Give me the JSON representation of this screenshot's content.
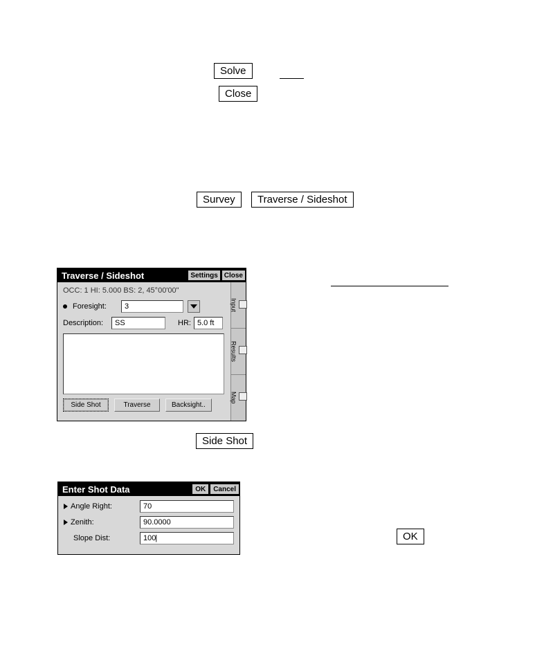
{
  "top_labels": {
    "solve": "Solve",
    "close": "Close"
  },
  "mid_labels": {
    "survey": "Survey",
    "traverse_sideshot": "Traverse / Sideshot",
    "side_shot": "Side Shot",
    "ok": "OK"
  },
  "win1": {
    "title": "Traverse / Sideshot",
    "tb_settings": "Settings",
    "tb_close": "Close",
    "occ_line": "OCC: 1 HI: 5.000 BS: 2, 45°00'00\"",
    "foresight_label": "Foresight:",
    "foresight_value": "3",
    "description_label": "Description:",
    "description_value": "SS",
    "hr_label": "HR:",
    "hr_value": "5.0 ft",
    "btn_sideshot": "Side Shot",
    "btn_traverse": "Traverse",
    "btn_backsight": "Backsight..",
    "tabs": {
      "input": "Input",
      "results": "Results",
      "map": "Map"
    }
  },
  "win2": {
    "title": "Enter Shot Data",
    "tb_ok": "OK",
    "tb_cancel": "Cancel",
    "rows": [
      {
        "label": "Angle Right:",
        "value": "70",
        "arrow": true
      },
      {
        "label": "Zenith:",
        "value": "90.0000",
        "arrow": true
      },
      {
        "label": "Slope Dist:",
        "value": "100",
        "arrow": false
      }
    ]
  }
}
